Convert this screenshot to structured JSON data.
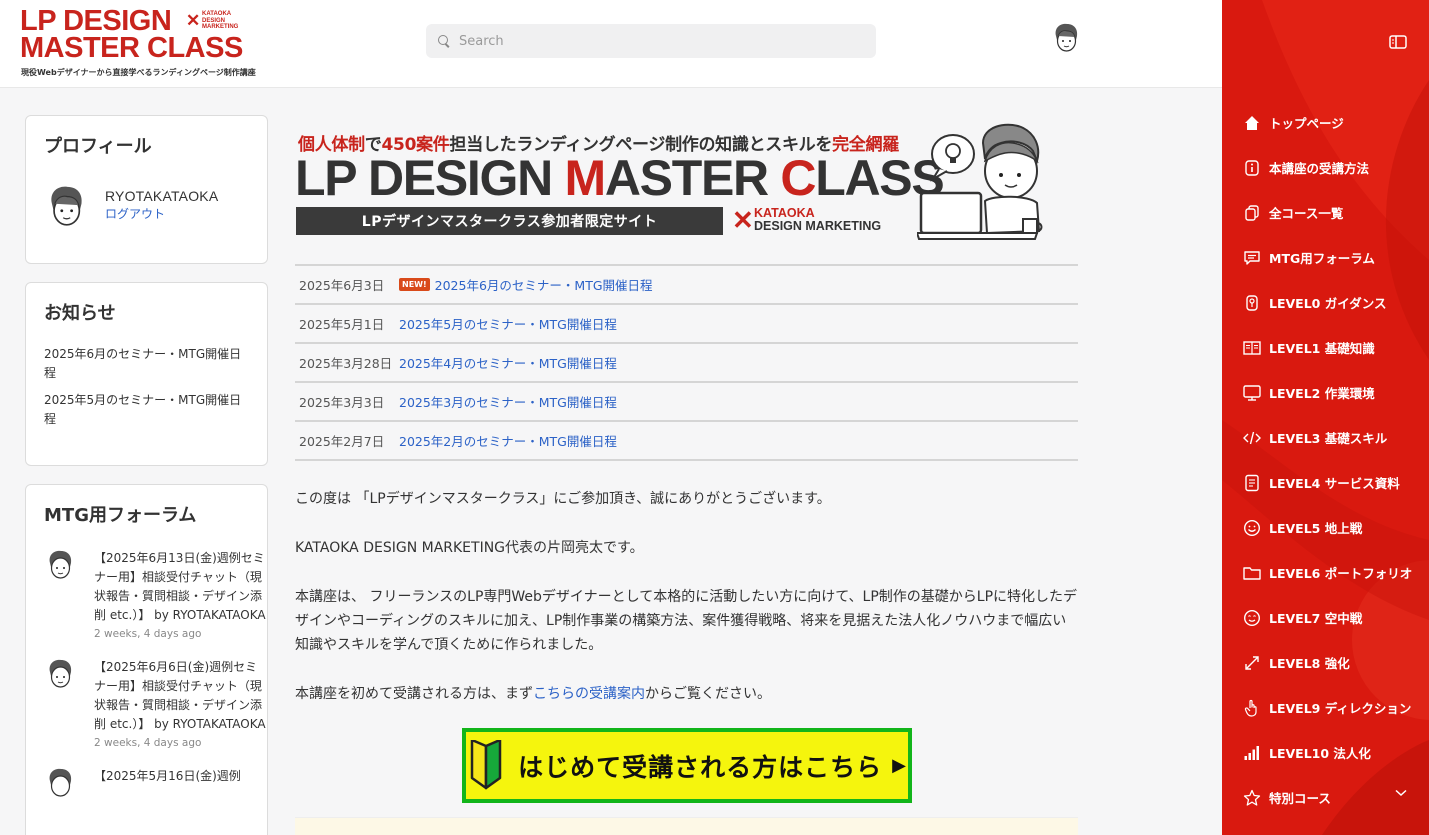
{
  "header": {
    "logo": {
      "line1a": "LP DESIGN",
      "line2a": "MASTER CLASS",
      "badge1": "KATAOKA",
      "badge2": "DESIGN",
      "badge3": "MARKETING",
      "subtitle": "現役Webデザイナーから直接学べるランディングページ制作講座"
    },
    "search_placeholder": "Search"
  },
  "profile": {
    "heading": "プロフィール",
    "name": "RYOTAKATAOKA",
    "logout": "ログアウト"
  },
  "notices": {
    "heading": "お知らせ",
    "items": [
      "2025年6月のセミナー・MTG開催日程",
      "2025年5月のセミナー・MTG開催日程"
    ]
  },
  "forum": {
    "heading": "MTG用フォーラム",
    "items": [
      {
        "title": "【2025年6月13日(金)週例セミナー用】相談受付チャット（現状報告・質問相談・デザイン添削 etc.）】 by RYOTAKATAOKA",
        "time": "2 weeks, 4 days ago"
      },
      {
        "title": "【2025年6月6日(金)週例セミナー用】相談受付チャット（現状報告・質問相談・デザイン添削 etc.）】 by RYOTAKATAOKA",
        "time": "2 weeks, 4 days ago"
      },
      {
        "title": "【2025年5月16日(金)週例",
        "time": ""
      }
    ]
  },
  "banner": {
    "tag_r1": "個人体制",
    "tag_d1": "で",
    "tag_r2": "450案件",
    "tag_d2": "担当したランディングページ制作の知識とスキルを",
    "tag_r3": "完全網羅",
    "title_a": "LP DESIGN ",
    "title_b": "M",
    "title_c": "ASTER ",
    "title_d": "C",
    "title_e": "LASS",
    "strip": "LPデザインマスタークラス参加者限定サイト",
    "brand1": "KATAOKA",
    "brand2": "DESIGN MARKETING"
  },
  "news": {
    "new_badge": "NEW!",
    "rows": [
      {
        "date": "2025年6月3日",
        "title": "2025年6月のセミナー・MTG開催日程",
        "is_new": true
      },
      {
        "date": "2025年5月1日",
        "title": "2025年5月のセミナー・MTG開催日程",
        "is_new": false
      },
      {
        "date": "2025年3月28日",
        "title": "2025年4月のセミナー・MTG開催日程",
        "is_new": false
      },
      {
        "date": "2025年3月3日",
        "title": "2025年3月のセミナー・MTG開催日程",
        "is_new": false
      },
      {
        "date": "2025年2月7日",
        "title": "2025年2月のセミナー・MTG開催日程",
        "is_new": false
      }
    ]
  },
  "body": {
    "p1": "この度は 「LPデザインマスタークラス」にご参加頂き、誠にありがとうございます。",
    "p2": "KATAOKA DESIGN MARKETING代表の片岡亮太です。",
    "p3": "本講座は、 フリーランスのLP専門Webデザイナーとして本格的に活動したい方に向けて、LP制作の基礎からLPに特化したデザインやコーディングのスキルに加え、LP制作事業の構築方法、案件獲得戦略、将来を見据えた法人化ノウハウまで幅広い知識やスキルを学んで頂くために作られました。",
    "p4_before": "本講座を初めて受講される方は、まず",
    "p4_link": "こちらの受講案内",
    "p4_after": "からご覧ください。"
  },
  "cta": {
    "label": "はじめて受講される方はこちら",
    "arrow": "▶"
  },
  "sidebar": {
    "items": [
      {
        "label": "トップページ",
        "icon": "home-icon"
      },
      {
        "label": "本講座の受講方法",
        "icon": "info-icon"
      },
      {
        "label": "全コース一覧",
        "icon": "copy-icon"
      },
      {
        "label": "MTG用フォーラム",
        "icon": "chat-icon"
      },
      {
        "label": "LEVEL0 ガイダンス",
        "icon": "badge-icon"
      },
      {
        "label": "LEVEL1 基礎知識",
        "icon": "book-icon"
      },
      {
        "label": "LEVEL2 作業環境",
        "icon": "monitor-icon"
      },
      {
        "label": "LEVEL3 基礎スキル",
        "icon": "code-icon"
      },
      {
        "label": "LEVEL4 サービス資料",
        "icon": "document-icon"
      },
      {
        "label": "LEVEL5 地上戦",
        "icon": "smile-icon"
      },
      {
        "label": "LEVEL6 ポートフォリオ",
        "icon": "folder-icon"
      },
      {
        "label": "LEVEL7 空中戦",
        "icon": "face-icon"
      },
      {
        "label": "LEVEL8 強化",
        "icon": "expand-icon"
      },
      {
        "label": "LEVEL9 ディレクション",
        "icon": "hand-icon"
      },
      {
        "label": "LEVEL10 法人化",
        "icon": "signal-icon"
      },
      {
        "label": "特別コース",
        "icon": "star-icon"
      }
    ]
  },
  "colors": {
    "accent": "#d9190f",
    "brand_red": "#c8241d",
    "link": "#2c62c7",
    "cta_yellow": "#f5f50d",
    "cta_green": "#12b51a"
  }
}
